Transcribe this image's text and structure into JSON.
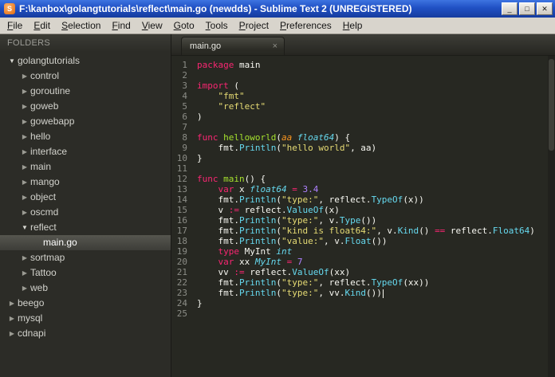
{
  "window": {
    "title": "F:\\kanbox\\golangtutorials\\reflect\\main.go (newdds) - Sublime Text 2 (UNREGISTERED)",
    "controls": {
      "minimize": "_",
      "maximize": "□",
      "close": "✕"
    }
  },
  "menu": {
    "items": [
      "File",
      "Edit",
      "Selection",
      "Find",
      "View",
      "Goto",
      "Tools",
      "Project",
      "Preferences",
      "Help"
    ]
  },
  "sidebar": {
    "header": "FOLDERS",
    "tree": [
      {
        "label": "golangtutorials",
        "depth": 0,
        "kind": "folder",
        "expanded": true
      },
      {
        "label": "control",
        "depth": 1,
        "kind": "folder",
        "expanded": false
      },
      {
        "label": "goroutine",
        "depth": 1,
        "kind": "folder",
        "expanded": false
      },
      {
        "label": "goweb",
        "depth": 1,
        "kind": "folder",
        "expanded": false
      },
      {
        "label": "gowebapp",
        "depth": 1,
        "kind": "folder",
        "expanded": false
      },
      {
        "label": "hello",
        "depth": 1,
        "kind": "folder",
        "expanded": false
      },
      {
        "label": "interface",
        "depth": 1,
        "kind": "folder",
        "expanded": false
      },
      {
        "label": "main",
        "depth": 1,
        "kind": "folder",
        "expanded": false
      },
      {
        "label": "mango",
        "depth": 1,
        "kind": "folder",
        "expanded": false
      },
      {
        "label": "object",
        "depth": 1,
        "kind": "folder",
        "expanded": false
      },
      {
        "label": "oscmd",
        "depth": 1,
        "kind": "folder",
        "expanded": false
      },
      {
        "label": "reflect",
        "depth": 1,
        "kind": "folder",
        "expanded": true
      },
      {
        "label": "main.go",
        "depth": 2,
        "kind": "file",
        "selected": true
      },
      {
        "label": "sortmap",
        "depth": 1,
        "kind": "folder",
        "expanded": false
      },
      {
        "label": "Tattoo",
        "depth": 1,
        "kind": "folder",
        "expanded": false
      },
      {
        "label": "web",
        "depth": 1,
        "kind": "folder",
        "expanded": false
      },
      {
        "label": "beego",
        "depth": 0,
        "kind": "folder",
        "expanded": false
      },
      {
        "label": "mysql",
        "depth": 0,
        "kind": "folder",
        "expanded": false
      },
      {
        "label": "cdnapi",
        "depth": 0,
        "kind": "folder",
        "expanded": false
      }
    ]
  },
  "tab": {
    "label": "main.go",
    "close": "×"
  },
  "editor": {
    "caret_line": 23,
    "lines": [
      [
        [
          "k",
          "package"
        ],
        [
          "t",
          " main"
        ]
      ],
      [],
      [
        [
          "k",
          "import"
        ],
        [
          "t",
          " ("
        ]
      ],
      [
        [
          "t",
          "    "
        ],
        [
          "s",
          "\"fmt\""
        ]
      ],
      [
        [
          "t",
          "    "
        ],
        [
          "s",
          "\"reflect\""
        ]
      ],
      [
        [
          "t",
          ")"
        ]
      ],
      [],
      [
        [
          "k",
          "func"
        ],
        [
          "t",
          " "
        ],
        [
          "f",
          "helloworld"
        ],
        [
          "t",
          "("
        ],
        [
          "p",
          "aa"
        ],
        [
          "t",
          " "
        ],
        [
          "ty",
          "float64"
        ],
        [
          "t",
          ") {"
        ]
      ],
      [
        [
          "t",
          "    fmt."
        ],
        [
          "c",
          "Println"
        ],
        [
          "t",
          "("
        ],
        [
          "s",
          "\"hello world\""
        ],
        [
          "t",
          ", aa)"
        ]
      ],
      [
        [
          "t",
          "}"
        ]
      ],
      [],
      [
        [
          "k",
          "func"
        ],
        [
          "t",
          " "
        ],
        [
          "f",
          "main"
        ],
        [
          "t",
          "() {"
        ]
      ],
      [
        [
          "t",
          "    "
        ],
        [
          "k",
          "var"
        ],
        [
          "t",
          " x "
        ],
        [
          "ty",
          "float64"
        ],
        [
          "t",
          " "
        ],
        [
          "o",
          "="
        ],
        [
          "t",
          " "
        ],
        [
          "n",
          "3.4"
        ]
      ],
      [
        [
          "t",
          "    fmt."
        ],
        [
          "c",
          "Println"
        ],
        [
          "t",
          "("
        ],
        [
          "s",
          "\"type:\""
        ],
        [
          "t",
          ", reflect."
        ],
        [
          "c",
          "TypeOf"
        ],
        [
          "t",
          "(x))"
        ]
      ],
      [
        [
          "t",
          "    v "
        ],
        [
          "o",
          ":="
        ],
        [
          "t",
          " reflect."
        ],
        [
          "c",
          "ValueOf"
        ],
        [
          "t",
          "(x)"
        ]
      ],
      [
        [
          "t",
          "    fmt."
        ],
        [
          "c",
          "Println"
        ],
        [
          "t",
          "("
        ],
        [
          "s",
          "\"type:\""
        ],
        [
          "t",
          ", v."
        ],
        [
          "c",
          "Type"
        ],
        [
          "t",
          "())"
        ]
      ],
      [
        [
          "t",
          "    fmt."
        ],
        [
          "c",
          "Println"
        ],
        [
          "t",
          "("
        ],
        [
          "s",
          "\"kind is float64:\""
        ],
        [
          "t",
          ", v."
        ],
        [
          "c",
          "Kind"
        ],
        [
          "t",
          "() "
        ],
        [
          "o",
          "=="
        ],
        [
          "t",
          " reflect."
        ],
        [
          "c",
          "Float64"
        ],
        [
          "t",
          ")"
        ]
      ],
      [
        [
          "t",
          "    fmt."
        ],
        [
          "c",
          "Println"
        ],
        [
          "t",
          "("
        ],
        [
          "s",
          "\"value:\""
        ],
        [
          "t",
          ", v."
        ],
        [
          "c",
          "Float"
        ],
        [
          "t",
          "())"
        ]
      ],
      [
        [
          "t",
          "    "
        ],
        [
          "k",
          "type"
        ],
        [
          "t",
          " MyInt "
        ],
        [
          "ty",
          "int"
        ]
      ],
      [
        [
          "t",
          "    "
        ],
        [
          "k",
          "var"
        ],
        [
          "t",
          " xx "
        ],
        [
          "ty",
          "MyInt"
        ],
        [
          "t",
          " "
        ],
        [
          "o",
          "="
        ],
        [
          "t",
          " "
        ],
        [
          "n",
          "7"
        ]
      ],
      [
        [
          "t",
          "    vv "
        ],
        [
          "o",
          ":="
        ],
        [
          "t",
          " reflect."
        ],
        [
          "c",
          "ValueOf"
        ],
        [
          "t",
          "(xx)"
        ]
      ],
      [
        [
          "t",
          "    fmt."
        ],
        [
          "c",
          "Println"
        ],
        [
          "t",
          "("
        ],
        [
          "s",
          "\"type:\""
        ],
        [
          "t",
          ", reflect."
        ],
        [
          "c",
          "TypeOf"
        ],
        [
          "t",
          "(xx))"
        ]
      ],
      [
        [
          "t",
          "    fmt."
        ],
        [
          "c",
          "Println"
        ],
        [
          "t",
          "("
        ],
        [
          "s",
          "\"type:\""
        ],
        [
          "t",
          ", vv."
        ],
        [
          "c",
          "Kind"
        ],
        [
          "t",
          "())"
        ]
      ],
      [
        [
          "t",
          "}"
        ]
      ],
      []
    ]
  },
  "colors": {
    "editor_background": "#272822",
    "keyword": "#f92672",
    "string": "#e6db74",
    "number": "#ae81ff",
    "function_name": "#a6e22e",
    "call_and_type": "#66d9ef",
    "parameter": "#fd971f",
    "plain_text": "#f8f8f2",
    "titlebar_blue": "#2050c4",
    "sidebar_background": "#2c2c27"
  }
}
